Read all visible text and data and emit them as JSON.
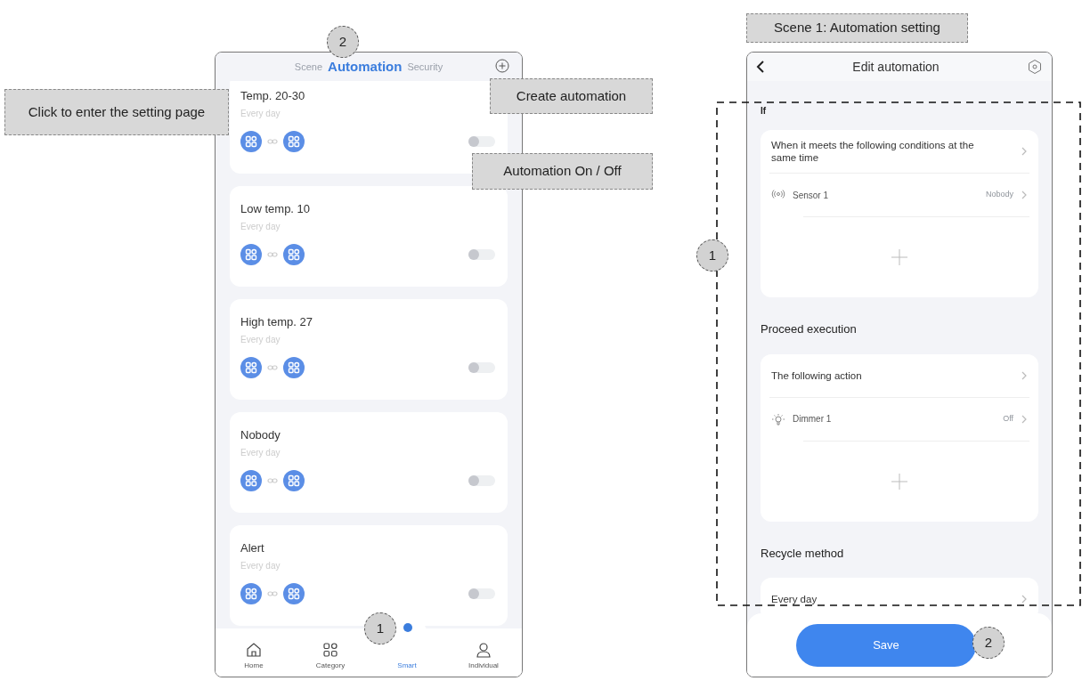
{
  "callouts": [
    {
      "text": "Click to enter the setting page"
    },
    {
      "text": "Create automation"
    },
    {
      "text": "Automation On / Off"
    },
    {
      "text": "Scene 1: Automation setting"
    }
  ],
  "markers": [
    {
      "text": "2"
    },
    {
      "text": "1"
    },
    {
      "text": "1"
    },
    {
      "text": "2"
    }
  ],
  "left_screen": {
    "tabs": [
      {
        "label": "Scene",
        "selected": false
      },
      {
        "label": "Automation",
        "selected": true
      },
      {
        "label": "Security",
        "selected": false
      }
    ],
    "automations": [
      {
        "title": "Temp. 20-30",
        "schedule": "Every day",
        "enabled": false
      },
      {
        "title": "Low temp. 10",
        "schedule": "Every day",
        "enabled": false
      },
      {
        "title": "High temp. 27",
        "schedule": "Every day",
        "enabled": false
      },
      {
        "title": "Nobody",
        "schedule": "Every day",
        "enabled": false
      },
      {
        "title": "Alert",
        "schedule": "Every day",
        "enabled": false
      }
    ],
    "nav": [
      {
        "kind": "home",
        "label": "Home",
        "selected": false
      },
      {
        "kind": "category",
        "label": "Category",
        "selected": false
      },
      {
        "kind": "smart",
        "label": "Smart",
        "selected": true
      },
      {
        "kind": "individual",
        "label": "Individual",
        "selected": false
      }
    ]
  },
  "right_screen": {
    "title": "Edit automation",
    "sections": [
      {
        "heading": "If",
        "summary": "When it meets the following conditions at the same time",
        "rows": [
          {
            "kind": "sensor",
            "name": "Sensor 1",
            "value": "Nobody"
          }
        ]
      },
      {
        "heading": "Proceed execution",
        "summary": "The following action",
        "rows": [
          {
            "kind": "light",
            "name": "Dimmer 1",
            "value": "Off"
          }
        ]
      },
      {
        "heading": "Recycle method",
        "summary": "Every day"
      }
    ],
    "button": "Save"
  }
}
